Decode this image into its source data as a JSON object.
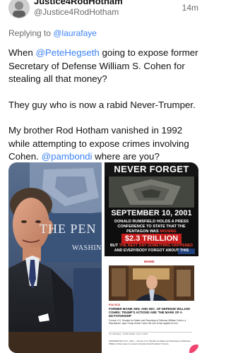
{
  "tweet": {
    "display_name": "Justice4RodHotham",
    "handle": "@Justice4RodHotham",
    "timestamp": "14m",
    "replying_prefix": "Replying to ",
    "replying_to": "@laurafaye",
    "p1_pre": "When ",
    "p1_mention": "@PeteHegseth",
    "p1_post": " going to expose former Secretary of Defense William S. Cohen for stealing all that money?",
    "p2": "They guy who is now a rabid Never-Trumper.",
    "p3_pre": "My brother Rod Hotham vanished in 1992 while attempting to expose crimes involving Cohen. ",
    "p3_mention": "@pambondi",
    "p3_post": " where are you?"
  },
  "media": {
    "left_sign_line1": "THE PEN",
    "left_sign_line2": "WASHIN",
    "right_top": {
      "title": "NEVER FORGET",
      "date": "SEPTEMBER 10, 2001",
      "line1_pre": "DONALD RUMSFIELD HOLDS A PRESS CONFERENCE TO STATE THAT THE PENTAGON WAS ",
      "line1_red": "MISSING",
      "amount": "$2.3 TRILLION",
      "line2_pre": "BUT ",
      "line2_red": "THE NEXT DAY SOMETHING HAPPENED",
      "line2_post": " AND EVERYBODY FORGOT ABOUT THIS"
    },
    "right_bottom": {
      "brand": "MAINE",
      "label": "POLITICS",
      "headline": "FORMER MAINE SEN. AND SEC. OF DEFENSE WILLIAM COHEN: TRUMP'S ACTIONS ARE 'THE MARK OF A DICTATORSHIP'",
      "subhead": "Former U.S. Senator for Maine and Secretary of Defense William Cohen, a Republican, says Trump doesn't have the rule of law applies to him.",
      "byline": "Tom Eldridge · PUBLISHED: July 8, 2020",
      "body": "WASHINGTON, D.C. (AP) — Former U.S. Senator for Maine and Secretary of Defense William Cohen says in a recent interview that President Trump's",
      "fab_icon": "plus"
    }
  },
  "colors": {
    "link": "#3b82f6",
    "muted": "#6b6b6b",
    "alert_red": "#c81d1d",
    "fab_pink": "#f0436e"
  }
}
